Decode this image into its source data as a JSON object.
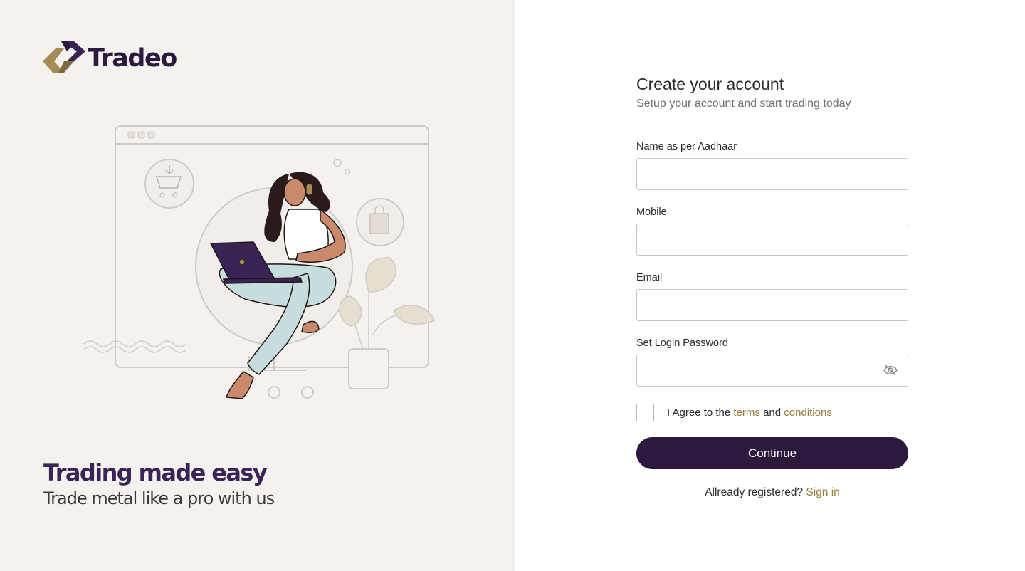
{
  "brand": {
    "name": "Tradeo"
  },
  "hero": {
    "title": "Trading made easy",
    "subtitle": "Trade metal like a pro with us"
  },
  "form": {
    "title": "Create your account",
    "subtitle": "Setup your account and start trading today",
    "fields": [
      {
        "label": "Name as per Aadhaar",
        "value": ""
      },
      {
        "label": "Mobile",
        "value": ""
      },
      {
        "label": "Email",
        "value": ""
      },
      {
        "label": "Set Login Password",
        "value": ""
      }
    ],
    "agree": {
      "prefix": "I Agree to the",
      "terms": "terms",
      "and": "and",
      "conditions": "conditions",
      "checked": false
    },
    "continue_label": "Continue",
    "registered": {
      "text": "Allready registered?",
      "link": "Sign in"
    }
  },
  "colors": {
    "brand_dark": "#2b1a3e",
    "gold": "#9a7a3f",
    "panel_bg": "#f4f1ee"
  },
  "icons": {
    "password_toggle": "eye-off-icon"
  }
}
